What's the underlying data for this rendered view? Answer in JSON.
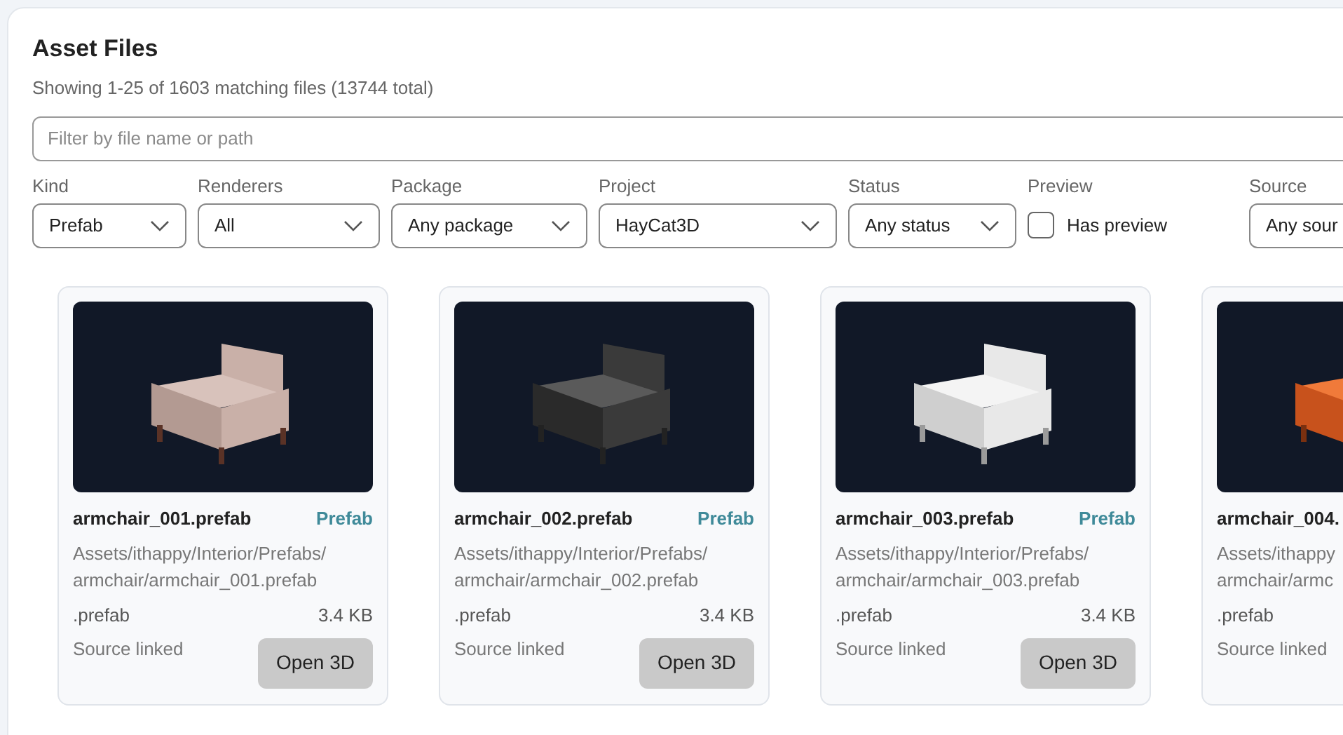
{
  "header": {
    "title": "Asset Files",
    "subtitle": "Showing 1-25 of 1603 matching files (13744 total)"
  },
  "search": {
    "placeholder": "Filter by file name or path"
  },
  "filters": [
    {
      "kind": "select",
      "label": "Kind",
      "value": "Prefab"
    },
    {
      "kind": "select",
      "label": "Renderers",
      "value": "All"
    },
    {
      "kind": "select",
      "label": "Package",
      "value": "Any package"
    },
    {
      "kind": "select",
      "label": "Project",
      "value": "HayCat3D"
    },
    {
      "kind": "select",
      "label": "Status",
      "value": "Any status"
    },
    {
      "kind": "checkbox",
      "label": "Preview",
      "value": "Has preview",
      "checked": false
    },
    {
      "kind": "select",
      "label": "Source",
      "value": "Any sour"
    }
  ],
  "cards": [
    {
      "name": "armchair_001.prefab",
      "badge": "Prefab",
      "path_lines": [
        "Assets/ithappy/Interior/Prefabs/",
        "armchair/armchair_001.prefab"
      ],
      "extension": ".prefab",
      "size": "3.4 KB",
      "source": "Source linked",
      "button": "Open 3D"
    },
    {
      "name": "armchair_002.prefab",
      "badge": "Prefab",
      "path_lines": [
        "Assets/ithappy/Interior/Prefabs/",
        "armchair/armchair_002.prefab"
      ],
      "extension": ".prefab",
      "size": "3.4 KB",
      "source": "Source linked",
      "button": "Open 3D"
    },
    {
      "name": "armchair_003.prefab",
      "badge": "Prefab",
      "path_lines": [
        "Assets/ithappy/Interior/Prefabs/",
        "armchair/armchair_003.prefab"
      ],
      "extension": ".prefab",
      "size": "3.4 KB",
      "source": "Source linked",
      "button": "Open 3D"
    },
    {
      "name": "armchair_004.",
      "path_lines": [
        "Assets/ithappy",
        "armchair/armc"
      ],
      "extension": ".prefab",
      "source": "Source linked"
    }
  ]
}
